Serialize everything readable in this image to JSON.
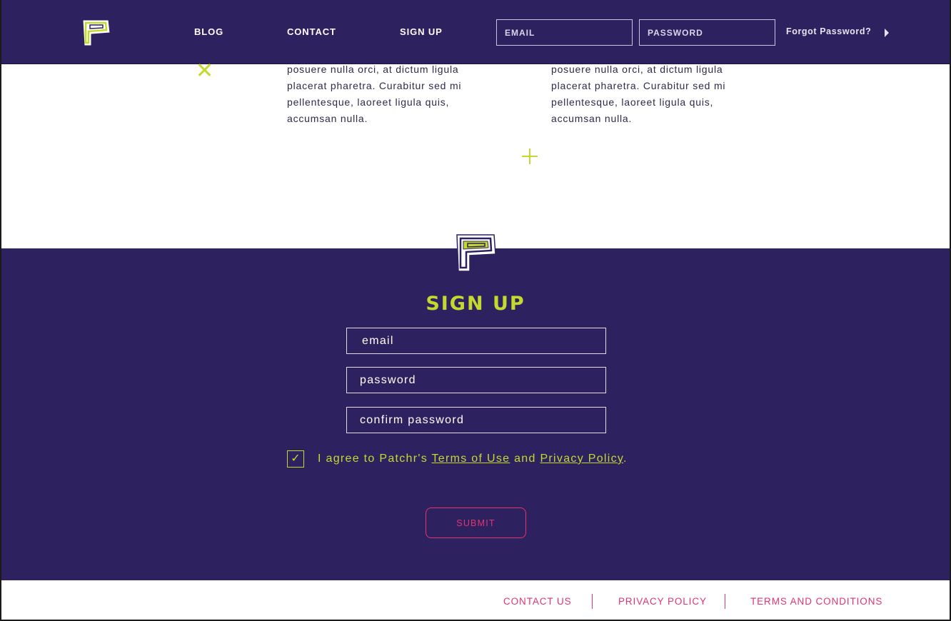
{
  "nav": {
    "logo_icon": "patchr-logo-icon",
    "links": [
      "BLOG",
      "CONTACT",
      "SIGN UP"
    ],
    "email_placeholder": "EMAIL",
    "password_placeholder": "PASSWORD",
    "forgot_label": "Forgot Password?",
    "forgot_icon": "caret-right-icon"
  },
  "content": {
    "paragraph_left": "posuere nulla orci, at dictum ligula placerat pharetra. Curabitur sed mi pellentesque, laoreet ligula quis, accumsan nulla.",
    "paragraph_right": "posuere nulla orci, at dictum ligula placerat pharetra. Curabitur sed mi pellentesque, laoreet ligula quis, accumsan nulla.",
    "decorations": [
      "x-mark-icon",
      "plus-mark-icon"
    ]
  },
  "signup": {
    "title": "SIGN UP",
    "email_placeholder": "email",
    "password_placeholder": "password",
    "confirm_placeholder": "confirm password",
    "agree_checked": true,
    "agree_prefix": "I agree to Patchr's ",
    "terms_label": "Terms of Use",
    "agree_middle": " and ",
    "privacy_label": "Privacy Policy",
    "agree_suffix": ".",
    "submit_label": "SUBMIT"
  },
  "footer": {
    "links": [
      "CONTACT US",
      "PRIVACY POLICY",
      "TERMS AND CONDITIONS"
    ]
  },
  "colors": {
    "brand_purple": "#2e2160",
    "accent_lime": "#c4d92e",
    "accent_pink": "#e3346f",
    "text_dark": "#2f2a4a"
  }
}
